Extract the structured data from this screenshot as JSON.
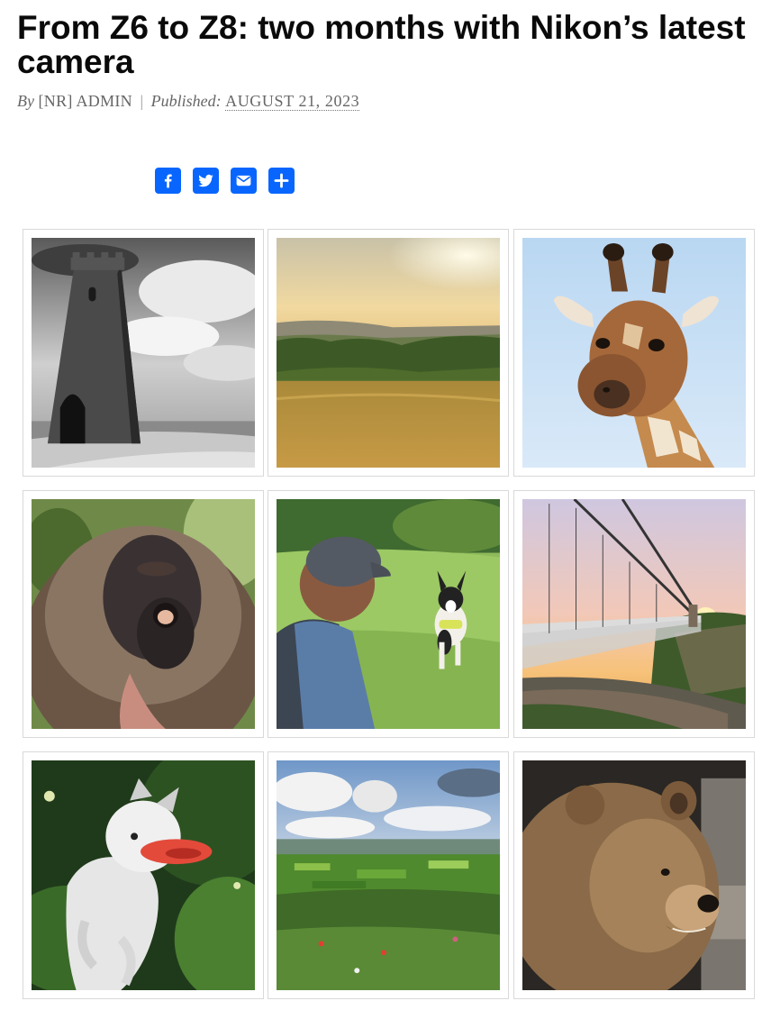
{
  "article": {
    "title": "From Z6 to Z8: two months with Nikon’s latest camera",
    "byline": {
      "by_label": "By",
      "author": "[NR] ADMIN",
      "separator": "|",
      "published_label": "Published:",
      "date": "AUGUST 21, 2023"
    }
  },
  "share": {
    "brand_color": "#0866ff",
    "buttons": [
      "facebook-icon",
      "twitter-icon",
      "email-icon",
      "plus-icon"
    ]
  },
  "gallery": {
    "images": [
      "tower-black-and-white-photo",
      "meadow-sunset-photo",
      "giraffe-photo",
      "gelada-monkey-photo",
      "woman-and-dog-photo",
      "suspension-bridge-photo",
      "dog-with-frisbee-photo",
      "countryside-landscape-photo",
      "brown-bear-photo"
    ]
  }
}
